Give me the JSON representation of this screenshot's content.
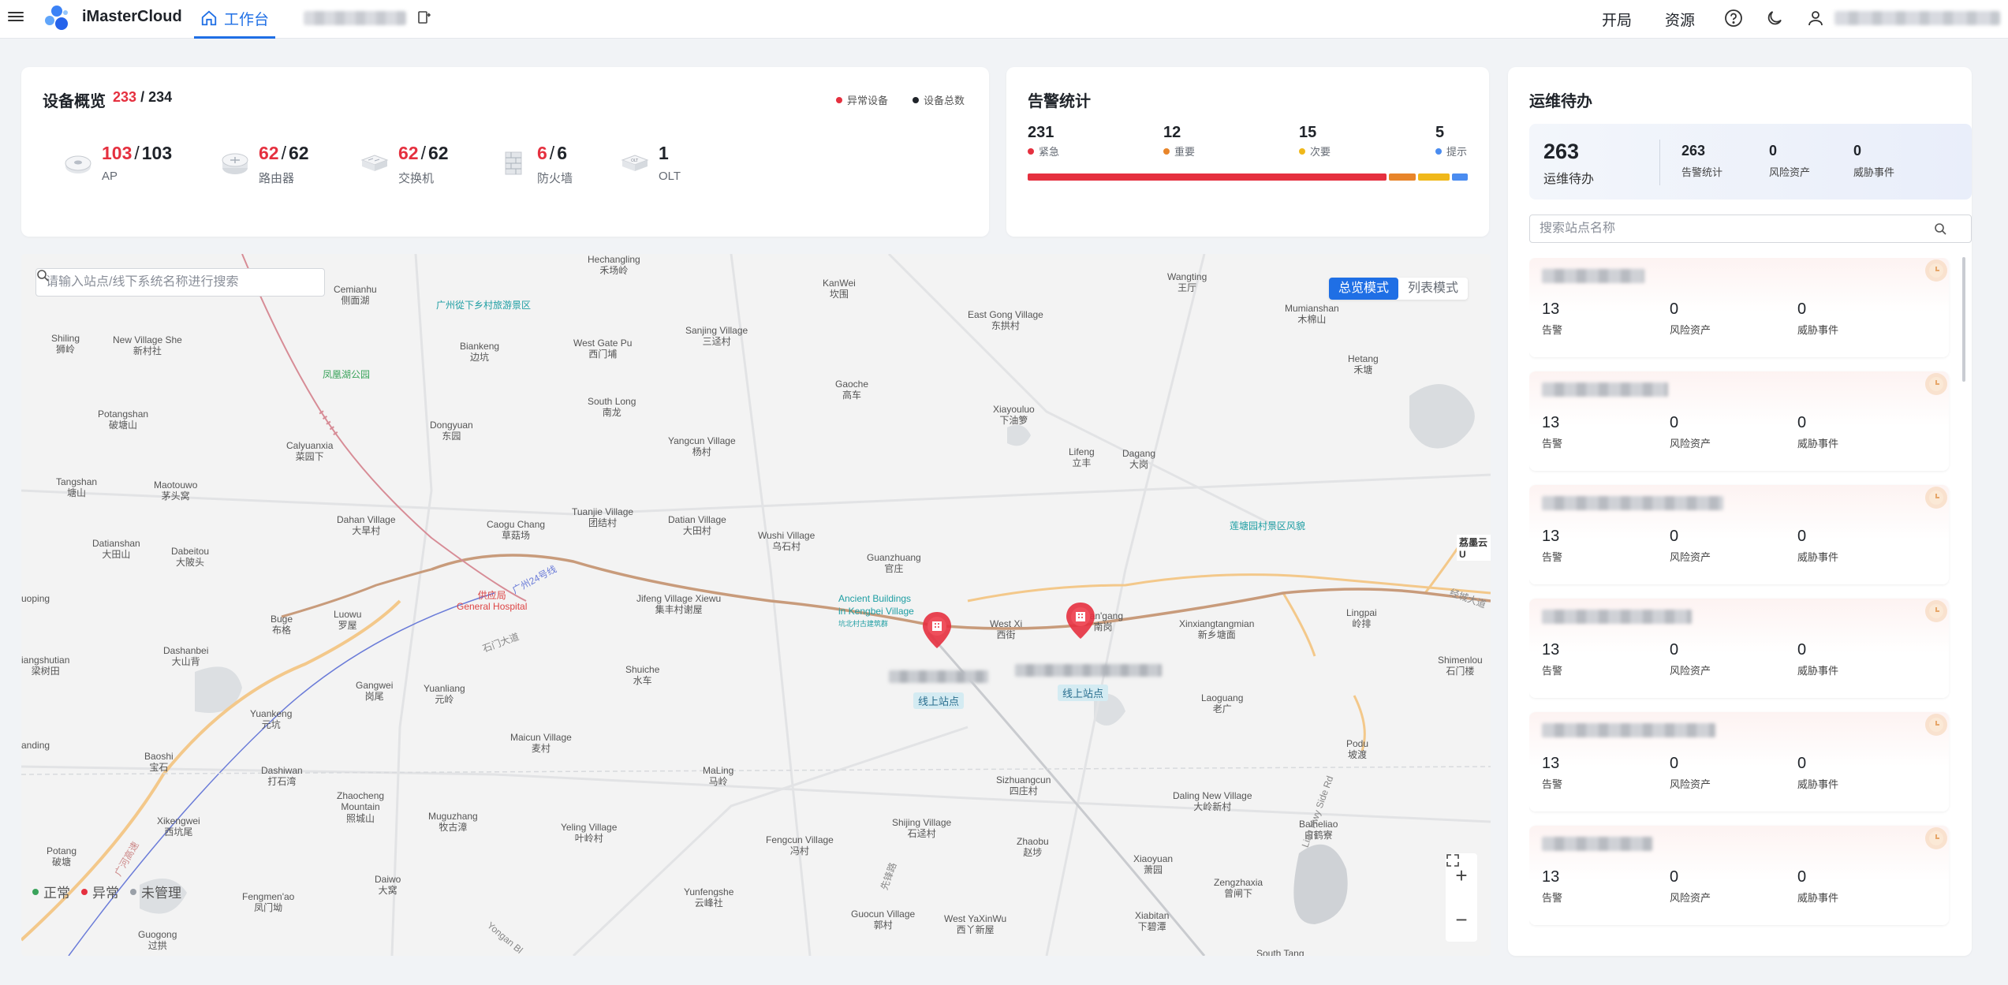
{
  "topbar": {
    "brand": "iMasterCloud",
    "home_tab": "工作台",
    "open_label": "开局",
    "resource_label": "资源",
    "icons": [
      "menu-icon",
      "logo-icon",
      "home-icon",
      "switch-icon",
      "help-icon",
      "moon-icon",
      "user-icon"
    ]
  },
  "device_overview": {
    "title": "设备概览",
    "abnormal_total": "233",
    "total": "234",
    "legend_abnormal": "异常设备",
    "legend_total": "设备总数",
    "devices": [
      {
        "abnormal": "103",
        "total": "103",
        "name": "AP",
        "icon": "ap-icon"
      },
      {
        "abnormal": "62",
        "total": "62",
        "name": "路由器",
        "icon": "router-icon"
      },
      {
        "abnormal": "62",
        "total": "62",
        "name": "交换机",
        "icon": "switch-device-icon"
      },
      {
        "abnormal": "6",
        "total": "6",
        "name": "防火墙",
        "icon": "firewall-icon"
      },
      {
        "abnormal": "",
        "total": "1",
        "name": "OLT",
        "icon": "olt-icon"
      }
    ],
    "colors": {
      "abnormal": "#e5303f",
      "total": "#1f2329"
    }
  },
  "alarm_stats": {
    "title": "告警统计",
    "levels": [
      {
        "value": "231",
        "label": "紧急",
        "color": "#e5303f"
      },
      {
        "value": "12",
        "label": "重要",
        "color": "#e8852a"
      },
      {
        "value": "15",
        "label": "次要",
        "color": "#f0b81a"
      },
      {
        "value": "5",
        "label": "提示",
        "color": "#4a8cf0"
      }
    ]
  },
  "map": {
    "search_placeholder": "请输入站点/线下系统名称进行搜索",
    "mode_overview": "总览模式",
    "mode_list": "列表模式",
    "legend": [
      {
        "label": "正常",
        "color": "#3aa35b"
      },
      {
        "label": "异常",
        "color": "#e5303f"
      },
      {
        "label": "未管理",
        "color": "#9aa0a8"
      }
    ],
    "site_tag": "线上站点",
    "places": {
      "hechangling": "Hechangling",
      "hechangling_cn": "禾场岭",
      "kanwei": "KanWei",
      "kanwei_cn": "坎围",
      "wangting": "Wangting",
      "wangting_cn": "王厅",
      "cemianhu": "Cemianhu",
      "cemianhu_cn": "侧面湖",
      "guangzhou_poi": "广州從下乡村旅游景区",
      "east_gong": "East Gong Village",
      "east_gong_cn": "东拱村",
      "mumianshan": "Mumianshan",
      "mumianshan_cn": "木棉山",
      "shiling": "Shiling",
      "shiling_cn": "狮岭",
      "new_village_she": "New Village She",
      "new_village_she_cn": "新村社",
      "biankeng": "Biankeng",
      "biankeng_cn": "边坑",
      "west_gate_pu": "West Gate Pu",
      "west_gate_pu_cn": "西门埔",
      "sanjing": "Sanjing Village",
      "sanjing_cn": "三迳村",
      "hetang": "Hetang",
      "hetang_cn": "禾塘",
      "fenghuang_park": "凤凰湖公园",
      "gaoche": "Gaoche",
      "gaoche_cn": "高车",
      "potangshan": "Potangshan",
      "potangshan_cn": "破塘山",
      "south_long": "South Long",
      "south_long_cn": "南龙",
      "xiayouluo": "Xiayouluo",
      "xiayouluo_cn": "下油箩",
      "dongyuan": "Dongyuan",
      "dongyuan_cn": "东园",
      "calyuanxia": "Calyuanxia",
      "calyuanxia_cn": "菜园下",
      "yangcun": "Yangcun Village",
      "yangcun_cn": "杨村",
      "lifeng": "Lifeng",
      "lifeng_cn": "立丰",
      "dagang": "Dagang",
      "dagang_cn": "大岗",
      "tangshan": "Tangshan",
      "tangshan_cn": "塘山",
      "maotouwo": "Maotouwo",
      "maotouwo_cn": "茅头窝",
      "tuanjie": "Tuanjie Village",
      "tuanjie_cn": "团结村",
      "dahan": "Dahan Village",
      "dahan_cn": "大旱村",
      "caogu": "Caogu Chang",
      "caogu_cn": "草菇场",
      "datian_v": "Datian Village",
      "datian_v_cn": "大田村",
      "wushi": "Wushi Village",
      "wushi_cn": "乌石村",
      "lianhua_poi": "莲塘园村景区风貌",
      "datianshan": "Datianshan",
      "datianshan_cn": "大田山",
      "dabeitou": "Dabeitou",
      "dabeitou_cn": "大陂头",
      "guanzhuang": "Guanzhuang",
      "guanzhuang_cn": "官庄",
      "ancient_1": "Ancient Buildings",
      "ancient_2": "in Kengbei Village",
      "ancient_cn": "坑北村古建筑群",
      "jifeng": "Jifeng Village Xiewu",
      "jifeng_cn": "集丰村谢屋",
      "hospital": "供应局",
      "hospital_en": "General Hospital",
      "xinhua": "兴华大道",
      "west_xi": "West Xi",
      "west_xi_cn": "西街",
      "nangang": "Nan'gang",
      "nangang_cn": "南岗",
      "xinxiang": "Xinxiangtangmian",
      "xinxiang_cn": "新乡塘面",
      "lingpai": "Lingpai",
      "lingpai_cn": "岭排",
      "huoping": "uoping",
      "bugte": "Buge",
      "bugte_cn": "布格",
      "luowu": "Luowu",
      "luowu_cn": "罗屋",
      "dashanbei": "Dashanbei",
      "dashanbei_cn": "大山背",
      "shuiche": "Shuiche",
      "shuiche_cn": "水车",
      "shimenlou": "Shimenlou",
      "shimenlou_cn": "石门楼",
      "liangshutian": "iangshutian",
      "liangshutian_cn": "梁树田",
      "gangwei": "Gangwei",
      "gangwei_cn": "岗尾",
      "yuanliang": "Yuanliang",
      "yuanliang_cn": "元岭",
      "laoguang": "Laoguang",
      "laoguang_cn": "老广",
      "yuankeng": "Yuankeng",
      "yuankeng_cn": "元坑",
      "maicun": "Maicun Village",
      "maicun_cn": "麦村",
      "podu": "Podu",
      "podu_cn": "坡渡",
      "baoshi": "Baoshi",
      "baoshi_cn": "宝石",
      "dashiwan": "Dashiwan",
      "dashiwan_cn": "打石湾",
      "maling": "MaLing",
      "maling_cn": "马岭",
      "sizhuangcun": "Sizhuangcun",
      "sizhuangcun_cn": "四庄村",
      "daling": "Daling New Village",
      "daling_cn": "大岭新村",
      "xikengwei": "Xikengwei",
      "xikengwei_cn": "西坑尾",
      "zhaocheng": "Zhaocheng",
      "zhaocheng2": "Mountain",
      "zhaocheng_cn": "照城山",
      "muguzhang": "Muguzhang",
      "muguzhang_cn": "牧古漳",
      "shijing": "Shijing Village",
      "shijing_cn": "石迳村",
      "yeling": "Yeling Village",
      "yeling_cn": "叶岭村",
      "fengcun": "Fengcun Village",
      "fengcun_cn": "冯村",
      "zhaobu": "Zhaobu",
      "zhaobu_cn": "赵埗",
      "baiheliao": "Baiheliao",
      "baiheliao_cn": "白鹤寮",
      "xiaoyuan": "Xiaoyuan",
      "xiaoyuan_cn": "萧园",
      "anding": "anding",
      "potang": "Potang",
      "potang_cn": "破塘",
      "daiwo": "Daiwo",
      "daiwo_cn": "大窝",
      "zengzhaxia": "Zengzhaxia",
      "zengzhaxia_cn": "曾闸下",
      "yunfengshe": "Yunfengshe",
      "yunfengshe_cn": "云峰社",
      "fengmenao": "Fengmen'ao",
      "fengmenao_cn": "凤门坳",
      "guocun": "Guocun Village",
      "guocun_cn": "郭村",
      "west_yaxin": "West YaXinWu",
      "west_yaxin_cn": "西丫新屋",
      "xiabitan": "Xiabitan",
      "xiabitan_cn": "下碧潭",
      "guogong": "Guogong",
      "guogong_cn": "过拱",
      "south_tang": "South Tang",
      "zengzhou_edge": "荔墨云U",
      "jingyu": "经城大道",
      "guanghui": "广河高速",
      "yiqi_road": "Lian Hwy Side Rd",
      "yongan": "Yongan Bl",
      "xianbi": "先锋路",
      "ls_road": "广州24号线",
      "shi_road": "石门大道"
    },
    "zoom_in": "+",
    "zoom_out": "−"
  },
  "todo": {
    "title": "运维待办",
    "total": "263",
    "total_label": "运维待办",
    "stats": [
      {
        "value": "263",
        "label": "告警统计"
      },
      {
        "value": "0",
        "label": "风险资产"
      },
      {
        "value": "0",
        "label": "威胁事件"
      }
    ],
    "search_placeholder": "搜索站点名称",
    "sites": [
      {
        "alarms": "13",
        "alarm_label": "告警",
        "risk": "0",
        "risk_label": "风险资产",
        "threat": "0",
        "threat_label": "威胁事件"
      },
      {
        "alarms": "13",
        "alarm_label": "告警",
        "risk": "0",
        "risk_label": "风险资产",
        "threat": "0",
        "threat_label": "威胁事件"
      },
      {
        "alarms": "13",
        "alarm_label": "告警",
        "risk": "0",
        "risk_label": "风险资产",
        "threat": "0",
        "threat_label": "威胁事件"
      },
      {
        "alarms": "13",
        "alarm_label": "告警",
        "risk": "0",
        "risk_label": "风险资产",
        "threat": "0",
        "threat_label": "威胁事件"
      },
      {
        "alarms": "13",
        "alarm_label": "告警",
        "risk": "0",
        "risk_label": "风险资产",
        "threat": "0",
        "threat_label": "威胁事件"
      },
      {
        "alarms": "13",
        "alarm_label": "告警",
        "risk": "0",
        "risk_label": "风险资产",
        "threat": "0",
        "threat_label": "威胁事件"
      }
    ]
  }
}
